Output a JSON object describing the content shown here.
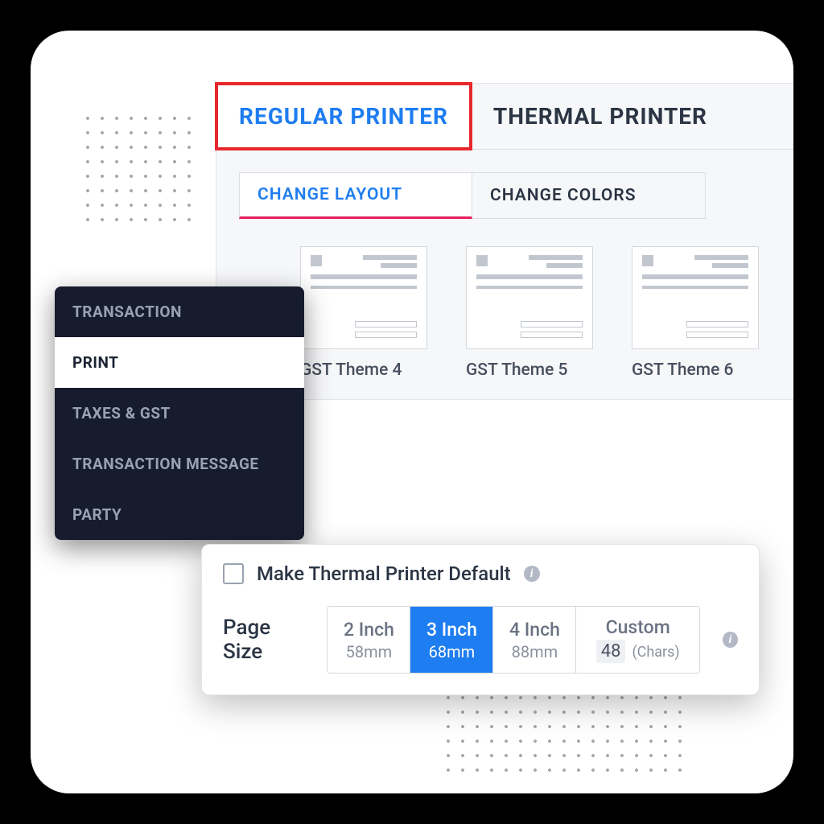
{
  "printerTabs": {
    "regular": "REGULAR PRINTER",
    "thermal": "THERMAL PRINTER"
  },
  "subTabs": {
    "layout": "CHANGE LAYOUT",
    "colors": "CHANGE COLORS"
  },
  "themes": [
    {
      "label": "GST Theme 4"
    },
    {
      "label": "GST Theme 5"
    },
    {
      "label": "GST Theme 6"
    }
  ],
  "sidebar": {
    "items": [
      "TRANSACTION",
      "PRINT",
      "TAXES & GST",
      "TRANSACTION MESSAGE",
      "PARTY"
    ],
    "activeIndex": 1
  },
  "thermal": {
    "defaultLabel": "Make Thermal Printer Default",
    "pageSizeLabel": "Page Size",
    "options": [
      {
        "title": "2 Inch",
        "sub": "58mm"
      },
      {
        "title": "3 Inch",
        "sub": "68mm"
      },
      {
        "title": "4 Inch",
        "sub": "88mm"
      }
    ],
    "activeIndex": 1,
    "custom": {
      "title": "Custom",
      "value": "48",
      "unit": "(Chars)"
    }
  },
  "icons": {
    "info": "i"
  },
  "colors": {
    "accent": "#1e7df0",
    "highlight": "#e8272c"
  }
}
